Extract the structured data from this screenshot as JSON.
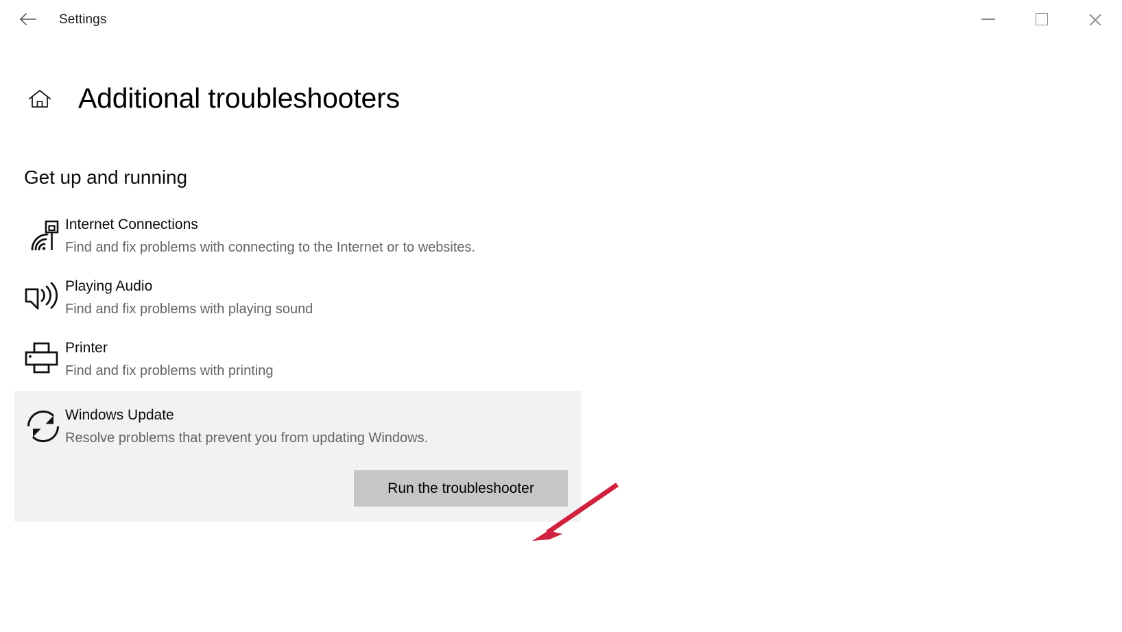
{
  "window": {
    "app_title": "Settings",
    "back_icon": "back-arrow-icon",
    "caption": {
      "minimize_label": "Minimize",
      "maximize_label": "Maximize",
      "close_label": "Close"
    }
  },
  "header": {
    "home_icon": "home-icon",
    "page_title": "Additional troubleshooters"
  },
  "section": {
    "title": "Get up and running"
  },
  "troubleshooters": [
    {
      "icon": "internet-connections-icon",
      "name": "Internet Connections",
      "description": "Find and fix problems with connecting to the Internet or to websites.",
      "selected": false
    },
    {
      "icon": "playing-audio-icon",
      "name": "Playing Audio",
      "description": "Find and fix problems with playing sound",
      "selected": false
    },
    {
      "icon": "printer-icon",
      "name": "Printer",
      "description": "Find and fix problems with printing",
      "selected": false
    },
    {
      "icon": "windows-update-icon",
      "name": "Windows Update",
      "description": "Resolve problems that prevent you from updating Windows.",
      "selected": true
    }
  ],
  "actions": {
    "run_troubleshooter_label": "Run the troubleshooter"
  },
  "annotation": {
    "arrow_color": "#d0223f",
    "points_to": "run-the-troubleshooter-button"
  },
  "colors": {
    "page_background": "#ffffff",
    "selected_tile_background": "#f2f2f2",
    "button_background": "#c6c6c6",
    "primary_text": "#0b0b0b",
    "secondary_text": "#636363",
    "caption_icon": "#8a8a8a"
  }
}
